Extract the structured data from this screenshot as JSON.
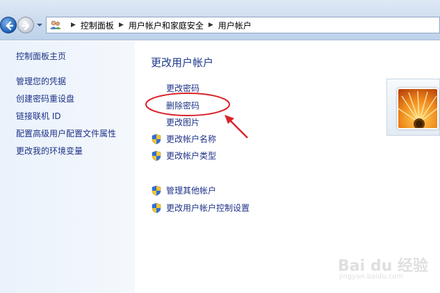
{
  "breadcrumb": {
    "items": [
      "控制面板",
      "用户帐户和家庭安全",
      "用户帐户"
    ]
  },
  "sidebar": {
    "items": [
      {
        "label": "控制面板主页"
      },
      {
        "label": "管理您的凭据"
      },
      {
        "label": "创建密码重设盘"
      },
      {
        "label": "链接联机 ID"
      },
      {
        "label": "配置高级用户配置文件属性"
      },
      {
        "label": "更改我的环境变量"
      }
    ]
  },
  "main": {
    "title": "更改用户帐户",
    "tasks": [
      {
        "label": "更改密码",
        "icon": "none"
      },
      {
        "label": "删除密码",
        "icon": "none",
        "highlighted": true
      },
      {
        "label": "更改图片",
        "icon": "none"
      },
      {
        "label": "更改帐户名称",
        "icon": "uac-shield-icon"
      },
      {
        "label": "更改帐户类型",
        "icon": "uac-shield-icon"
      }
    ],
    "other_tasks": [
      {
        "label": "管理其他帐户",
        "icon": "uac-shield-icon"
      },
      {
        "label": "更改用户帐户控制设置",
        "icon": "uac-shield-icon"
      }
    ]
  },
  "annotation": {
    "color": "#d9232a"
  },
  "watermark": {
    "brand": "Bai du 经验",
    "sub": "jingyan.baidu.com"
  },
  "colors": {
    "link": "#1e3287",
    "accent": "#d9232a"
  }
}
